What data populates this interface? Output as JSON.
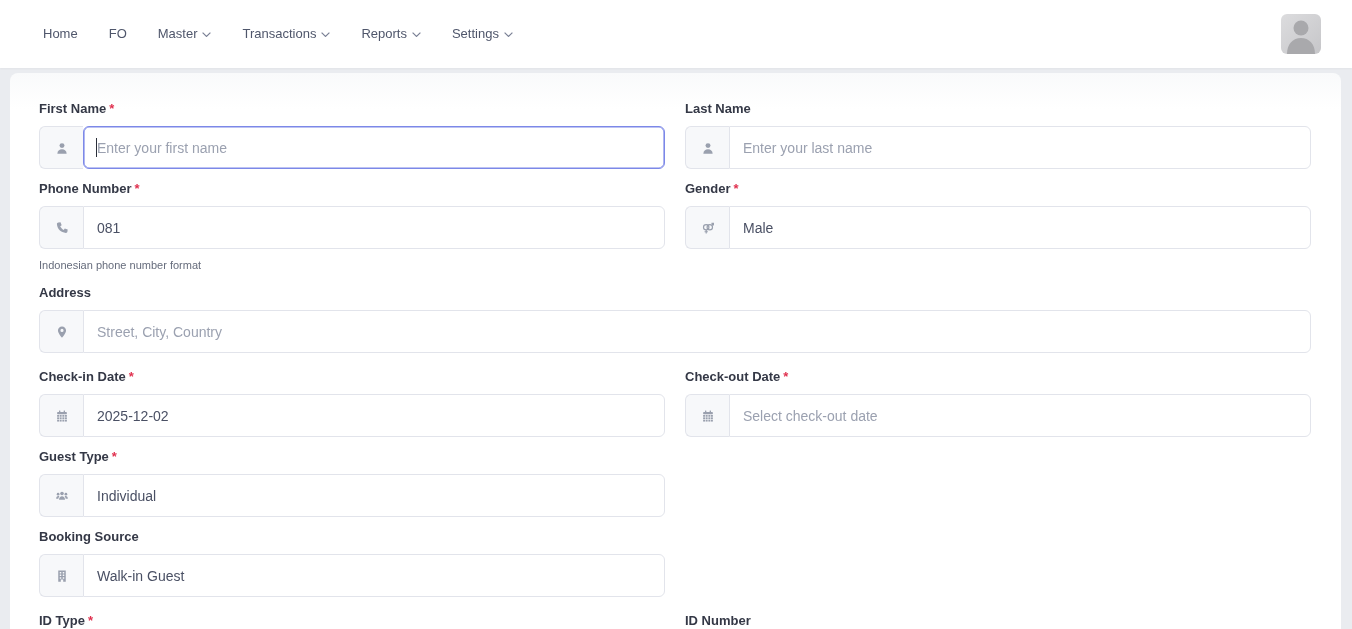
{
  "nav": {
    "items": [
      {
        "label": "Home",
        "dropdown": false
      },
      {
        "label": "FO",
        "dropdown": false
      },
      {
        "label": "Master",
        "dropdown": true
      },
      {
        "label": "Transactions",
        "dropdown": true
      },
      {
        "label": "Reports",
        "dropdown": true
      },
      {
        "label": "Settings",
        "dropdown": true
      }
    ]
  },
  "form": {
    "sections": [
      {
        "rows": [
          {
            "kind": "pair",
            "fields": [
              {
                "label": "First Name",
                "required_mark": "*",
                "input": {
                  "kind": "name",
                  "placeholder": "Enter your first name",
                  "focused": true
                }
              },
              {
                "label": "Last Name",
                "input": {
                  "kind": "name",
                  "placeholder": "Enter your last name",
                  "focused": false
                }
              }
            ]
          },
          {
            "kind": "pair",
            "fields": [
              {
                "label": "Phone Number",
                "required_mark": "*",
                "input": {
                  "kind": "phone",
                  "value": "081",
                  "focused": false
                },
                "hint": "Indonesian phone number format"
              },
              {
                "label": "Gender",
                "required_mark": "*",
                "input": {
                  "kind": "gender",
                  "value": "Male",
                  "focused": false
                }
              }
            ]
          },
          {
            "kind": "wide",
            "fields": [
              {
                "label": "Address",
                "input": {
                  "kind": "address",
                  "placeholder": "Street, City, Country",
                  "focused": false
                }
              }
            ]
          }
        ]
      },
      {
        "rows": [
          {
            "kind": "pair",
            "fields": [
              {
                "label": "Check-in Date",
                "required_mark": "*",
                "input": {
                  "kind": "date",
                  "value": "2025-12-02",
                  "focused": false
                }
              },
              {
                "label": "Check-out Date",
                "required_mark": "*",
                "input": {
                  "kind": "date",
                  "placeholder": "Select check-out date",
                  "focused": false
                }
              }
            ]
          },
          {
            "kind": "pair",
            "fields": [
              {
                "label": "Guest Type",
                "required_mark": "*",
                "input": {
                  "kind": "guest",
                  "value": "Individual",
                  "focused": false
                }
              }
            ]
          },
          {
            "kind": "pair",
            "fields": [
              {
                "label": "Booking Source",
                "input": {
                  "kind": "source",
                  "value": "Walk-in Guest",
                  "focused": false
                }
              }
            ]
          }
        ]
      },
      {
        "rows": [
          {
            "kind": "pair",
            "fields": [
              {
                "label": "ID Type",
                "required_mark": "*"
              },
              {
                "label": "ID Number"
              }
            ]
          }
        ]
      }
    ]
  }
}
